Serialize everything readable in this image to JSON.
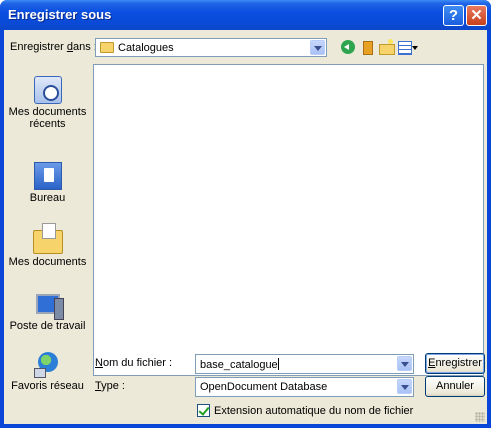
{
  "window": {
    "title": "Enregistrer sous",
    "help_label": "?",
    "close_label": "✕"
  },
  "lookin": {
    "label_pre": "Enregistrer ",
    "label_u": "d",
    "label_post": "ans :",
    "value": "Catalogues"
  },
  "places": [
    {
      "label": "Mes documents récents",
      "icon": "recent-documents-icon"
    },
    {
      "label": "Bureau",
      "icon": "desktop-icon"
    },
    {
      "label": "Mes documents",
      "icon": "my-documents-icon"
    },
    {
      "label": "Poste de travail",
      "icon": "my-computer-icon"
    },
    {
      "label": "Favoris réseau",
      "icon": "network-places-icon"
    }
  ],
  "filename": {
    "label_u": "N",
    "label_post": "om du fichier :",
    "value": "base_catalogue"
  },
  "filetype": {
    "label_u": "T",
    "label_post": "ype :",
    "value": "OpenDocument Database"
  },
  "buttons": {
    "save_u": "E",
    "save_post": "nregistrer",
    "cancel": "Annuler"
  },
  "auto_extension": {
    "label": "Extension automatique du nom de fichier",
    "checked": true
  }
}
